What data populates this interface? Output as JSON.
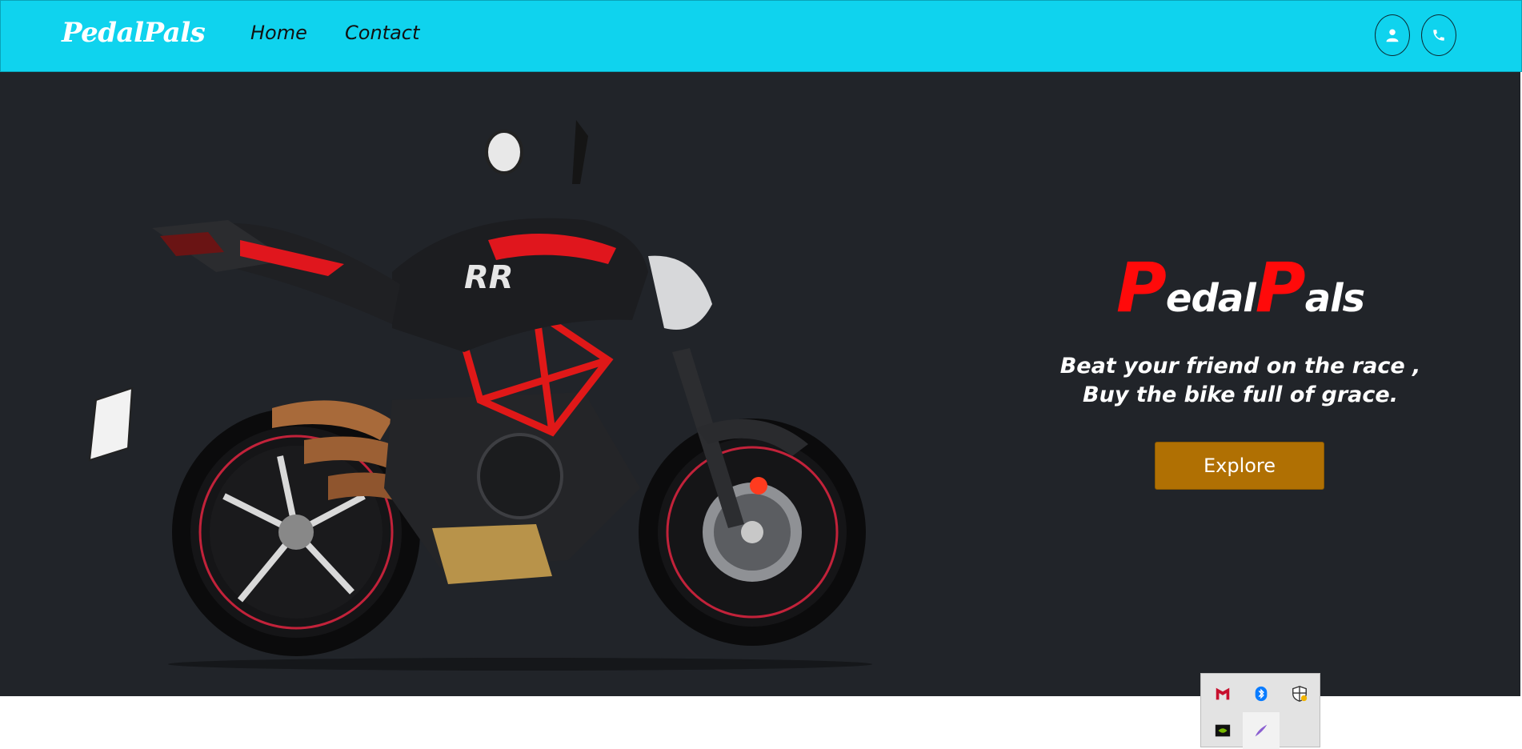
{
  "navbar": {
    "brand": "PedalPals",
    "links": [
      {
        "label": "Home"
      },
      {
        "label": "Contact"
      }
    ],
    "user_icon": "user-icon",
    "phone_icon": "phone-icon"
  },
  "hero": {
    "title_first_letter": "P",
    "title_part1": "edal",
    "title_second_letter": "P",
    "title_part2": "als",
    "tagline_line1": "Beat your friend on the race ,",
    "tagline_line2": "Buy the bike full of grace.",
    "cta_label": "Explore",
    "image": "motorcycle"
  },
  "system_tray": {
    "icons": [
      "mcafee-icon",
      "bluetooth-icon",
      "windows-security-icon",
      "nvidia-icon",
      "pen-icon"
    ]
  },
  "colors": {
    "navbar_bg": "#0fd3ee",
    "hero_bg": "#212429",
    "accent_red": "#ff0a0a",
    "cta_bg": "#b07003"
  }
}
